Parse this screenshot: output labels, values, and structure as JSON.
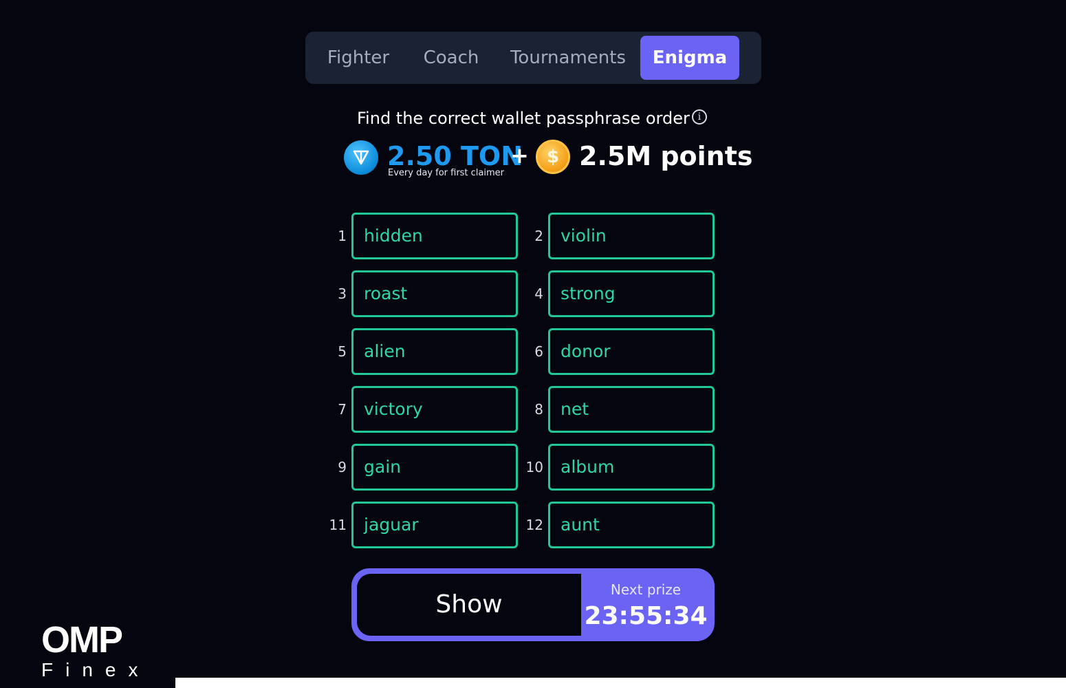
{
  "tabs": [
    {
      "label": "Fighter",
      "active": false
    },
    {
      "label": "Coach",
      "active": false
    },
    {
      "label": "Tournaments",
      "active": false
    },
    {
      "label": "Enigma",
      "active": true
    }
  ],
  "header": {
    "title": "Find the correct wallet passphrase order",
    "info_icon": "i"
  },
  "reward": {
    "ton_amount": "2.50 TON",
    "ton_subtitle": "Every day for first claimer",
    "plus": "+",
    "coin_symbol": "$",
    "points": "2.5M points"
  },
  "words": [
    {
      "num": "1",
      "word": "hidden"
    },
    {
      "num": "2",
      "word": "violin"
    },
    {
      "num": "3",
      "word": "roast"
    },
    {
      "num": "4",
      "word": "strong"
    },
    {
      "num": "5",
      "word": "alien"
    },
    {
      "num": "6",
      "word": "donor"
    },
    {
      "num": "7",
      "word": "victory"
    },
    {
      "num": "8",
      "word": "net"
    },
    {
      "num": "9",
      "word": "gain"
    },
    {
      "num": "10",
      "word": "album"
    },
    {
      "num": "11",
      "word": "jaguar"
    },
    {
      "num": "12",
      "word": "aunt"
    }
  ],
  "action": {
    "show_label": "Show",
    "next_label": "Next prize",
    "timer": "23:55:34"
  },
  "watermark": {
    "main": "OMP",
    "sub": "Finex"
  },
  "colors": {
    "background": "#05050f",
    "accent": "#6a63f4",
    "word_border": "#1fc79a",
    "ton_blue": "#1e9bf0",
    "coin_gold": "#f5a21a"
  }
}
